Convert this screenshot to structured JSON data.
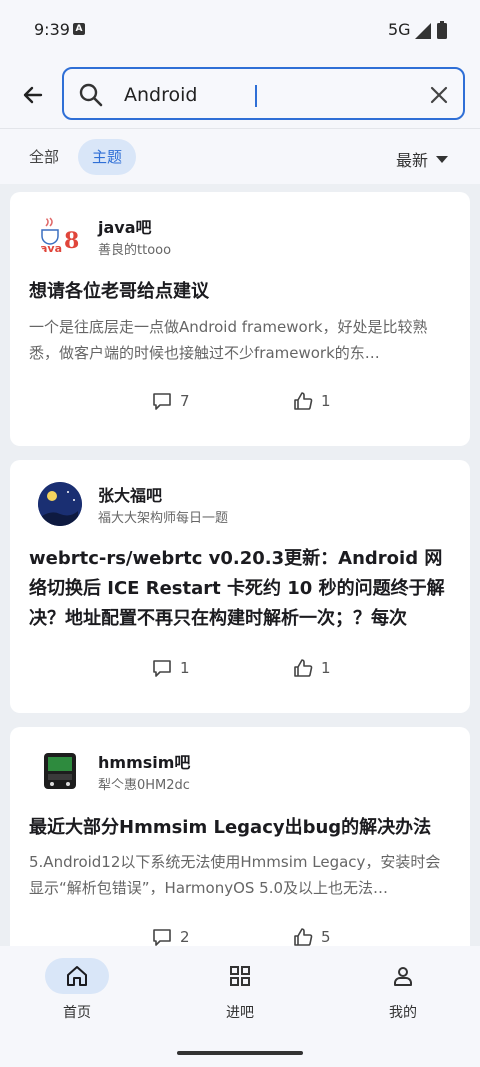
{
  "status": {
    "time": "9:39",
    "a_badge": "A",
    "network": "5G"
  },
  "search": {
    "value": "Android"
  },
  "filters": {
    "all": "全部",
    "topic": "主题",
    "sort": "最新"
  },
  "posts": [
    {
      "forum": "java吧",
      "author": "善良的ttooo",
      "title": "想请各位老哥给点建议",
      "excerpt": "一个是往底层走一点做Android framework，好处是比较熟悉，做客户端的时候也接触过不少framework的东…",
      "comments": "7",
      "likes": "1"
    },
    {
      "forum": "张大福吧",
      "author": "福大大架构师每日一题",
      "title": "webrtc-rs/webrtc v0.20.3更新：Android 网络切换后 ICE Restart 卡死约 10 秒的问题终于解决？地址配置不再只在构建时解析一次；？每次 bin…",
      "excerpt": "",
      "comments": "1",
      "likes": "1"
    },
    {
      "forum": "hmmsim吧",
      "author": "犁亽惠0HM2dc",
      "title": "最近大部分Hmmsim Legacy出bug的解决办法",
      "excerpt": "5.Android12以下系统无法使用Hmmsim Legacy，安装时会显示“解析包错误”，HarmonyOS 5.0及以上也无法…",
      "comments": "2",
      "likes": "5"
    }
  ],
  "nav": {
    "home": "首页",
    "forums": "进吧",
    "mine": "我的"
  },
  "colors": {
    "accent": "#2f6fd6",
    "accent_light": "#d9e6f8"
  }
}
